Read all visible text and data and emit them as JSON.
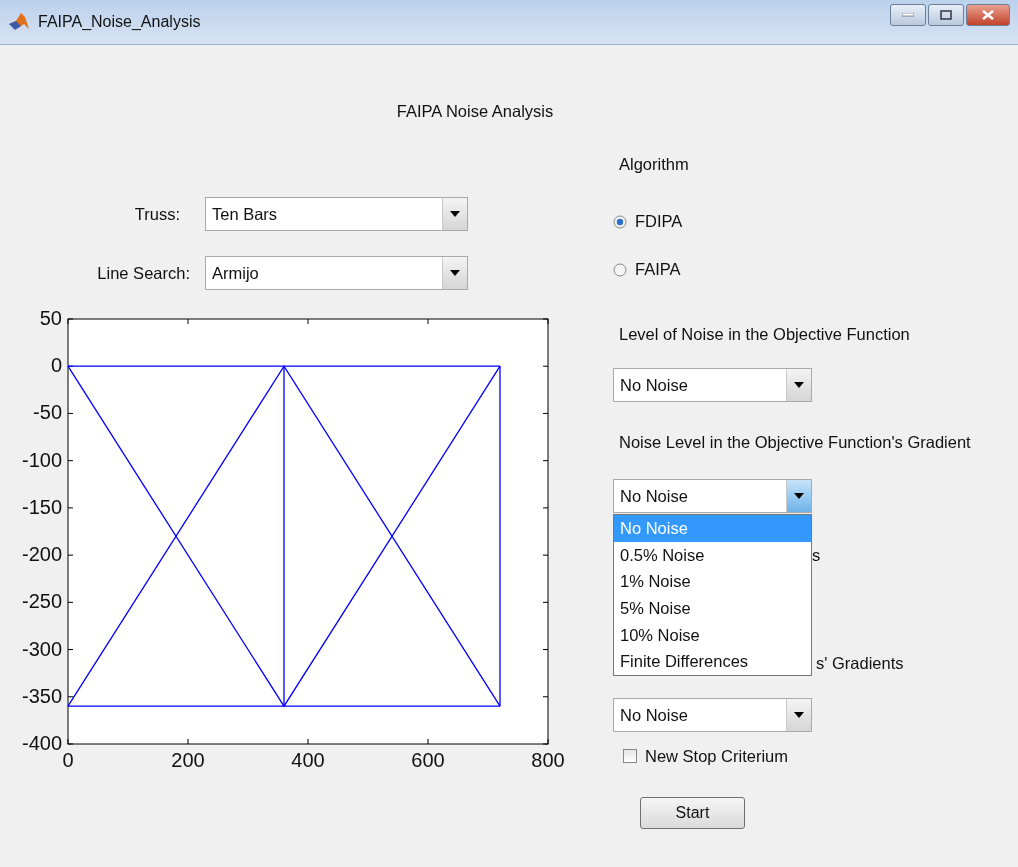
{
  "window": {
    "title": "FAIPA_Noise_Analysis"
  },
  "heading": "FAIPA Noise Analysis",
  "truss": {
    "label": "Truss:",
    "value": "Ten Bars"
  },
  "line_search": {
    "label": "Line Search:",
    "value": "Armijo"
  },
  "chart_data": {
    "type": "line",
    "xlim": [
      0,
      800
    ],
    "ylim": [
      -400,
      50
    ],
    "xticks": [
      0,
      200,
      400,
      600,
      800
    ],
    "yticks": [
      50,
      0,
      -50,
      -100,
      -150,
      -200,
      -250,
      -300,
      -350,
      -400
    ],
    "series": [
      {
        "color": "#0000ff",
        "x": [
          0,
          360,
          720
        ],
        "values": [
          0,
          0,
          0
        ]
      },
      {
        "color": "#0000ff",
        "x": [
          0,
          360,
          720
        ],
        "values": [
          -360,
          -360,
          -360
        ]
      },
      {
        "color": "#0000ff",
        "x": [
          0,
          360,
          720
        ],
        "values": [
          0,
          -360,
          0
        ]
      },
      {
        "color": "#0000ff",
        "x": [
          0,
          360,
          720
        ],
        "values": [
          -360,
          0,
          -360
        ]
      },
      {
        "color": "#0000ff",
        "x": [
          360,
          360
        ],
        "values": [
          0,
          -360
        ]
      },
      {
        "color": "#0000ff",
        "x": [
          720,
          720
        ],
        "values": [
          0,
          -360
        ]
      }
    ]
  },
  "algorithm": {
    "label": "Algorithm",
    "options": [
      {
        "label": "FDIPA",
        "selected": true
      },
      {
        "label": "FAIPA",
        "selected": false
      }
    ]
  },
  "objective_noise": {
    "label": "Level of Noise in the Objective Function",
    "value": "No Noise"
  },
  "gradient_noise": {
    "label": "Noise Level in the Objective Function's Gradient",
    "value": "No Noise",
    "expanded": true,
    "options": [
      {
        "label": "No Noise",
        "selected": true
      },
      {
        "label": "0.5% Noise",
        "selected": false
      },
      {
        "label": "1% Noise",
        "selected": false
      },
      {
        "label": "5% Noise",
        "selected": false
      },
      {
        "label": "10% Noise",
        "selected": false
      },
      {
        "label": "Finite Differences",
        "selected": false
      }
    ]
  },
  "partial_label": "s",
  "constraint_gradient_noise": {
    "label": "s' Gradients",
    "value": "No Noise"
  },
  "stop_criterion": {
    "label": "New Stop Criterium",
    "checked": false
  },
  "start_button": "Start"
}
